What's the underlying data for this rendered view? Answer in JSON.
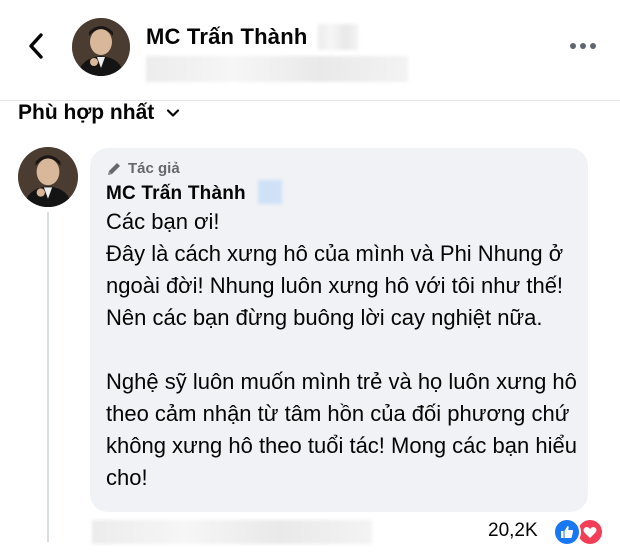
{
  "header": {
    "page_name": "MC Trấn Thành",
    "back_icon": "chevron-left-icon",
    "more_icon": "more-horizontal-icon"
  },
  "sort": {
    "label": "Phù hợp nhất",
    "icon": "chevron-down-icon"
  },
  "comment": {
    "badge_icon": "pen-icon",
    "badge_label": "Tác giả",
    "author": "MC Trấn Thành",
    "text": "Các bạn ơi!\nĐây là cách xưng hô của mình và Phi Nhung ở ngoài đời! Nhung luôn xưng hô với tôi như thế! Nên các bạn đừng buông lời cay nghiệt nữa.\n\nNghệ sỹ luôn muốn mình trẻ và họ luôn xưng hô theo cảm nhận từ tâm hồn của đối phương chứ không xưng hô theo tuổi tác!  Mong các bạn hiểu cho!"
  },
  "reactions": {
    "count": "20,2K",
    "icons": [
      "like-icon",
      "love-icon"
    ]
  },
  "colors": {
    "bubble_bg": "#f0f2f5",
    "like": "#1877f2",
    "love": "#f33e58",
    "secondary_text": "#65676b"
  }
}
